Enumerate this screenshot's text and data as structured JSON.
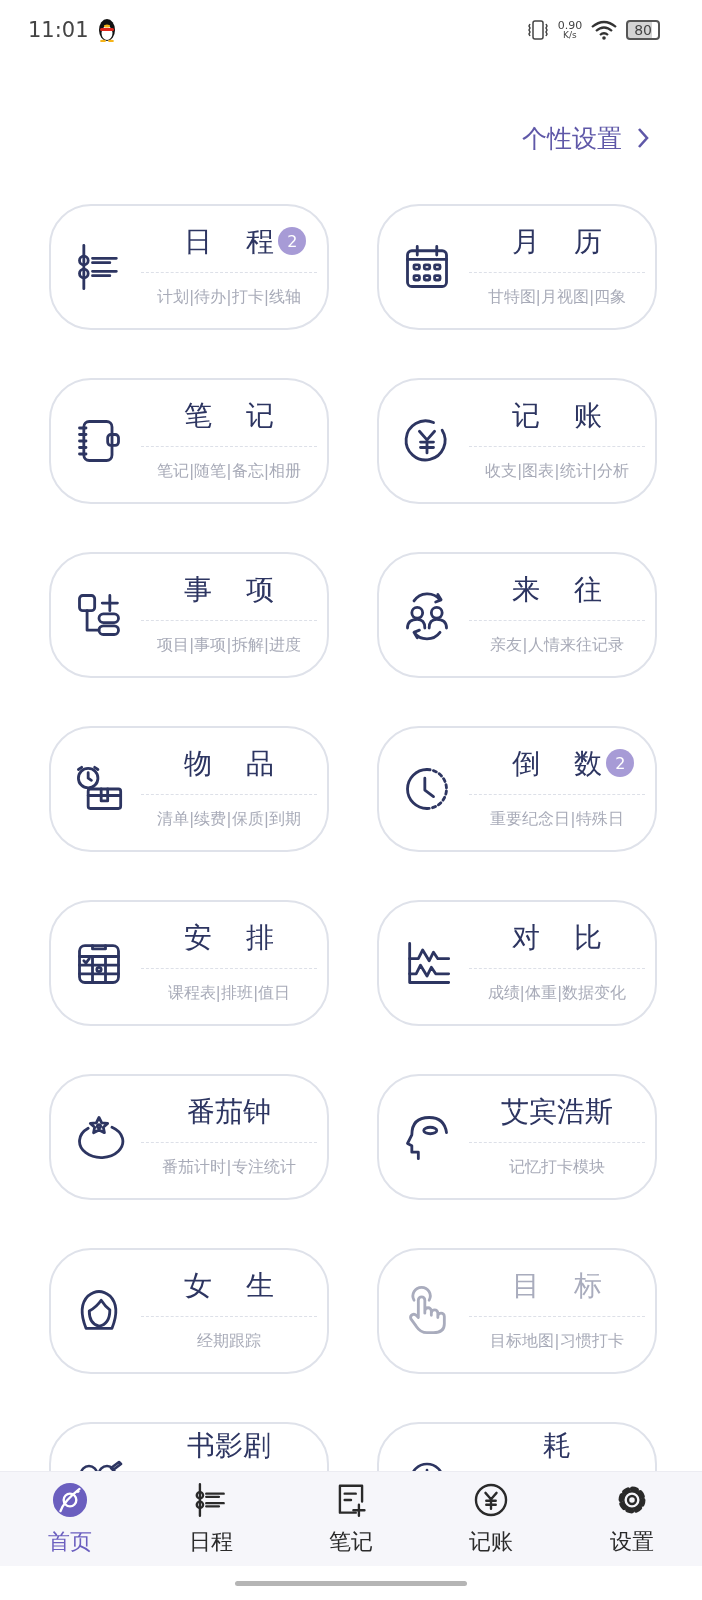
{
  "status_bar": {
    "time": "11:01",
    "net_speed": "0.90",
    "net_unit": "K/s",
    "battery": "80"
  },
  "header": {
    "link": "个性设置"
  },
  "cards": [
    {
      "title": "日 程",
      "subtitle": "计划|待办|打卡|线轴",
      "badge": "2",
      "disabled": false
    },
    {
      "title": "月 历",
      "subtitle": "甘特图|月视图|四象",
      "disabled": false
    },
    {
      "title": "笔 记",
      "subtitle": "笔记|随笔|备忘|相册",
      "disabled": false
    },
    {
      "title": "记 账",
      "subtitle": "收支|图表|统计|分析",
      "disabled": false
    },
    {
      "title": "事 项",
      "subtitle": "项目|事项|拆解|进度",
      "disabled": false
    },
    {
      "title": "来 往",
      "subtitle": "亲友|人情来往记录",
      "disabled": false
    },
    {
      "title": "物 品",
      "subtitle": "清单|续费|保质|到期",
      "disabled": false
    },
    {
      "title": "倒 数",
      "subtitle": "重要纪念日|特殊日",
      "badge": "2",
      "disabled": false
    },
    {
      "title": "安 排",
      "subtitle": "课程表|排班|值日",
      "disabled": false
    },
    {
      "title": "对 比",
      "subtitle": "成绩|体重|数据变化",
      "disabled": false
    },
    {
      "title": "番茄钟",
      "subtitle": "番茄计时|专注统计",
      "disabled": false
    },
    {
      "title": "艾宾浩斯",
      "subtitle": "记忆打卡模块",
      "disabled": false
    },
    {
      "title": "女 生",
      "subtitle": "经期跟踪",
      "disabled": false
    },
    {
      "title": "目 标",
      "subtitle": "目标地图|习惯打卡",
      "disabled": true
    },
    {
      "title": "书影剧",
      "disabled": false
    },
    {
      "title": "耗",
      "disabled": false
    }
  ],
  "tabs": [
    {
      "label": "首页",
      "selected": true
    },
    {
      "label": "日程",
      "selected": false
    },
    {
      "label": "笔记",
      "selected": false
    },
    {
      "label": "记账",
      "selected": false
    },
    {
      "label": "设置",
      "selected": false
    }
  ]
}
